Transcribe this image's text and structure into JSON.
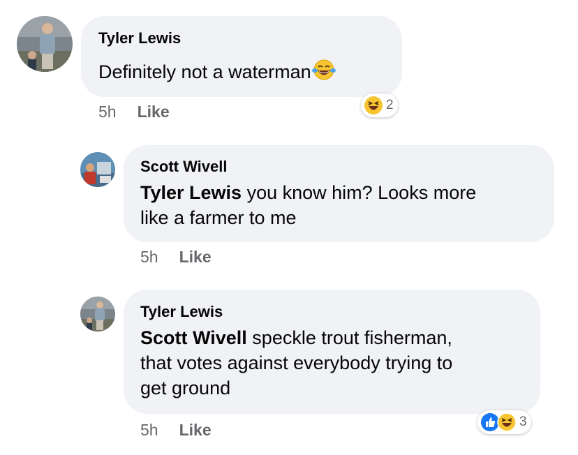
{
  "comments": [
    {
      "author": "Tyler Lewis",
      "mention": "",
      "text": "Definitely not a waterman",
      "time": "5h",
      "like_label": "Like",
      "reactions": [
        "haha"
      ],
      "reaction_count": "2"
    },
    {
      "author": "Scott Wivell",
      "mention": "Tyler Lewis",
      "line1": " you know him? Looks more",
      "line2": "like a farmer to me",
      "time": "5h",
      "like_label": "Like"
    },
    {
      "author": "Tyler Lewis",
      "mention": "Scott Wivell",
      "line1": " speckle trout fisherman,",
      "line2": "that votes against everybody trying to",
      "line3": "get ground",
      "time": "5h",
      "like_label": "Like",
      "reactions": [
        "like",
        "haha"
      ],
      "reaction_count": "3"
    }
  ],
  "colors": {
    "bubble": "#f0f2f5",
    "meta_text": "#65676b",
    "like_blue": "#1877f2",
    "haha_yellow": "#f7c531"
  }
}
